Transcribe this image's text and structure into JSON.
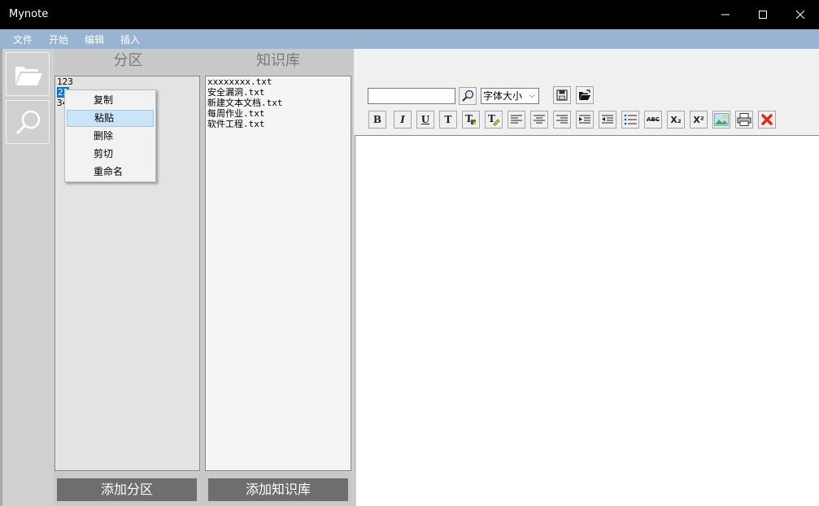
{
  "window": {
    "title": "Mynote"
  },
  "menu": [
    "文件",
    "开始",
    "编辑",
    "插入"
  ],
  "sections_panel": {
    "header": "分区",
    "items": [
      "123",
      "23",
      "34"
    ],
    "selected_index": 1,
    "add_button": "添加分区"
  },
  "knowledge_panel": {
    "header": "知识库",
    "items": [
      "xxxxxxxx.txt",
      "安全漏洞.txt",
      "新建文本文档.txt",
      "每周作业.txt",
      "软件工程.txt"
    ],
    "add_button": "添加知识库"
  },
  "context_menu": {
    "items": [
      "复制",
      "粘贴",
      "删除",
      "剪切",
      "重命名"
    ],
    "highlighted": "粘贴"
  },
  "toolbar": {
    "search_value": "",
    "font_size_placeholder": "字体大小",
    "bold_label": "B",
    "italic_label": "I",
    "underline_label": "U",
    "text_label": "T",
    "subscript_label": "X₂",
    "superscript_label": "X²",
    "strike_label": "ABC"
  },
  "colors": {
    "titlebar": "#000000",
    "menubar": "#99b4d1",
    "button_gray": "#6e6e6e",
    "selection": "#0078d7"
  }
}
